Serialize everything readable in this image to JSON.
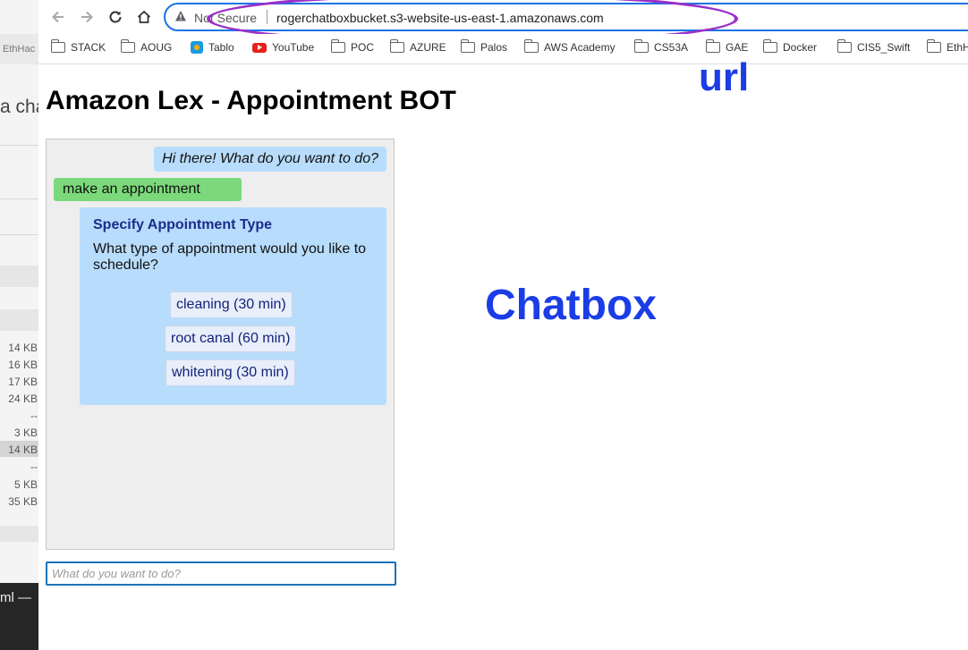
{
  "background_window": {
    "tab_text": "EthHac",
    "heading_fragment": "a cha",
    "file_sizes": [
      "14 KB",
      "16 KB",
      "17 KB",
      "24 KB",
      "--",
      "3 KB",
      "14 KB",
      "--",
      "5 KB",
      "35 KB"
    ],
    "terminal_fragment": "ml —"
  },
  "browser": {
    "icons": {
      "back": "back-arrow-icon",
      "forward": "forward-arrow-icon",
      "reload": "reload-icon",
      "home": "home-icon",
      "warning": "warning-icon"
    },
    "security_label": "Not Secure",
    "url": "rogerchatboxbucket.s3-website-us-east-1.amazonaws.com",
    "bookmarks": [
      {
        "label": "STACK",
        "icon": "folder-icon"
      },
      {
        "label": "AOUG",
        "icon": "folder-icon"
      },
      {
        "label": "Tablo",
        "icon": "tablo-icon"
      },
      {
        "label": "YouTube",
        "icon": "youtube-icon"
      },
      {
        "label": "POC",
        "icon": "folder-icon"
      },
      {
        "label": "AZURE",
        "icon": "folder-icon"
      },
      {
        "label": "Palos",
        "icon": "folder-icon"
      },
      {
        "label": "AWS Academy",
        "icon": "folder-icon"
      },
      {
        "label": "CS53A",
        "icon": "folder-icon"
      },
      {
        "label": "GAE",
        "icon": "folder-icon"
      },
      {
        "label": "Docker",
        "icon": "folder-icon"
      },
      {
        "label": "CIS5_Swift",
        "icon": "folder-icon"
      },
      {
        "label": "EthH",
        "icon": "folder-icon"
      }
    ]
  },
  "annotations": {
    "url_label": "url",
    "chatbox_label": "Chatbox",
    "ellipse_color": "#9b30c8",
    "label_color": "#1a3de6"
  },
  "page": {
    "title": "Amazon Lex - Appointment BOT",
    "chat": {
      "bot_greeting": "Hi there! What do you want to do?",
      "user_message": "make an appointment",
      "card_title": "Specify Appointment Type",
      "card_prompt": "What type of appointment would you like to schedule?",
      "options": [
        "cleaning (30 min)",
        "root canal (60 min)",
        "whitening (30 min)"
      ],
      "input_placeholder": "What do you want to do?"
    }
  }
}
